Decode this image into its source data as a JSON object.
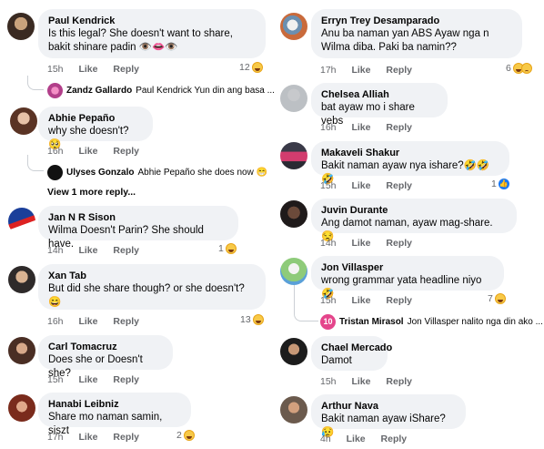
{
  "labels": {
    "like": "Like",
    "reply": "Reply",
    "view_more": "View 1 more reply..."
  },
  "left": {
    "paul": {
      "name": "Paul Kendrick",
      "text": "Is this legal? She doesn't want to share, bakit shinare padin 👁️👄👁️",
      "time": "15h",
      "count": "12"
    },
    "paul_reply": {
      "name": "Zandz Gallardo",
      "text": "Paul Kendrick Yun din ang basa ..."
    },
    "abhie": {
      "name": "Abhie Pepaño",
      "text": "why she doesn't? 🥺",
      "time": "16h"
    },
    "abhie_reply": {
      "name": "Ulyses Gonzalo",
      "text": "Abhie Pepaño she does now 😁"
    },
    "jan": {
      "name": "Jan N R Sison",
      "text": "Wilma Doesn't Parin? She should have.",
      "time": "14h",
      "count": "1"
    },
    "xan": {
      "name": "Xan Tab",
      "text": "But did she share though? or she doesn't? 😄",
      "time": "16h",
      "count": "13"
    },
    "carl": {
      "name": "Carl Tomacruz",
      "text": "Does she or Doesn't she?",
      "time": "15h"
    },
    "hanabi": {
      "name": "Hanabi Leibniz",
      "text": "Share mo naman samin, siszt",
      "time": "17h",
      "count": "2"
    }
  },
  "right": {
    "erryn": {
      "name": "Erryn Trey Desamparado",
      "text": "Anu ba naman yan ABS Ayaw nga n Wilma diba. Paki ba namin??",
      "time": "17h",
      "count": "6"
    },
    "chelsea": {
      "name": "Chelsea Alliah",
      "text": "bat ayaw mo i share vebs",
      "time": "16h"
    },
    "makaveli": {
      "name": "Makaveli Shakur",
      "text": "Bakit naman ayaw nya ishare?🤣🤣🤣",
      "time": "15h",
      "count": "1"
    },
    "juvin": {
      "name": "Juvin Durante",
      "text": "Ang damot naman, ayaw mag-share. 😒",
      "time": "14h"
    },
    "jon": {
      "name": "Jon Villasper",
      "text": "wrong grammar yata headline niyo 🤣",
      "time": "15h",
      "count": "7"
    },
    "jon_reply": {
      "badge": "10",
      "name": "Tristan Mirasol",
      "text": "Jon Villasper nalito nga din ako ..."
    },
    "chael": {
      "name": "Chael Mercado",
      "text": "Damot",
      "time": "15h"
    },
    "arthur": {
      "name": "Arthur Nava",
      "text": "Bakit naman ayaw iShare? 😥",
      "time": "4h"
    }
  }
}
